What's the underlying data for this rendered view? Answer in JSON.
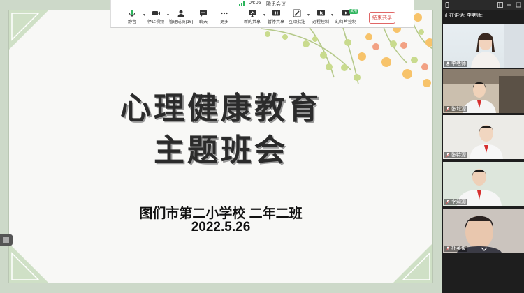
{
  "meeting": {
    "time": "04:05",
    "app_title": "腾讯会议"
  },
  "toolbar": {
    "buttons": [
      {
        "id": "mute",
        "label": "静音"
      },
      {
        "id": "stop_video",
        "label": "停止视频"
      },
      {
        "id": "manage_members",
        "label": "管理成员(16)"
      },
      {
        "id": "chat",
        "label": "聊天"
      },
      {
        "id": "more",
        "label": "更多"
      },
      {
        "id": "new_share",
        "label": "新的共享"
      },
      {
        "id": "pause_share",
        "label": "暂停共享"
      },
      {
        "id": "annotate",
        "label": "互动批注"
      },
      {
        "id": "remote_control",
        "label": "远程控制"
      },
      {
        "id": "slide_control",
        "label": "幻灯片控制"
      }
    ],
    "badge": "试用",
    "end_share_label": "结束共享"
  },
  "slide": {
    "title_line1": "心理健康教育",
    "title_line2": "主题班会",
    "school": "图们市第二小学校  二年二班",
    "date": "2022.5.26"
  },
  "panel": {
    "speaking": "正在讲话: 李老师;",
    "participants": [
      {
        "name": "李老师"
      },
      {
        "name": "张城源"
      },
      {
        "name": "张特源"
      },
      {
        "name": "李知源"
      },
      {
        "name": "朴英俊"
      }
    ]
  },
  "colors": {
    "accent_green": "#2db55d",
    "end_share_red": "#d9534f",
    "panel_bg": "#1e1e1e"
  }
}
